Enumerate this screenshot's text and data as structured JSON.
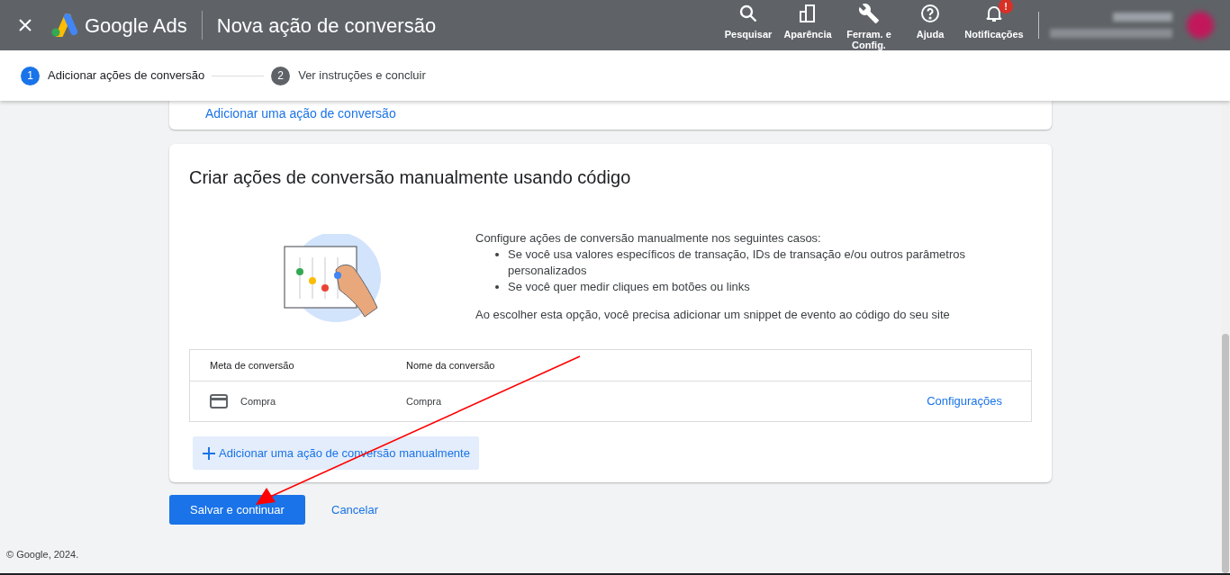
{
  "header": {
    "brand": "Google Ads",
    "title": "Nova ação de conversão",
    "actions": [
      {
        "kind": "search",
        "label": "Pesquisar"
      },
      {
        "kind": "appearance",
        "label": "Aparência"
      },
      {
        "kind": "tools",
        "label": "Ferram. e Config."
      },
      {
        "kind": "help",
        "label": "Ajuda"
      },
      {
        "kind": "bell",
        "label": "Notificações",
        "badge": "!"
      }
    ]
  },
  "stepper": [
    {
      "number": "1",
      "label": "Adicionar ações de conversão",
      "selected": true
    },
    {
      "number": "2",
      "label": "Ver instruções e concluir",
      "selected": false
    }
  ],
  "previous_card": {
    "link": "Adicionar uma ação de conversão"
  },
  "manual_card": {
    "title": "Criar ações de conversão manualmente usando código",
    "intro": "Configure ações de conversão manualmente nos seguintes casos:",
    "bullets": [
      "Se você usa valores específicos de transação, IDs de transação e/ou outros parâmetros personalizados",
      "Se você quer medir cliques em botões ou links"
    ],
    "note": "Ao escolher esta opção, você precisa adicionar um snippet de evento ao código do seu site",
    "table": {
      "columns": [
        "Meta de conversão",
        "Nome da conversão"
      ],
      "rows": [
        {
          "goal": "Compra",
          "name": "Compra",
          "action": "Configurações"
        }
      ]
    },
    "add_button": "Adicionar uma ação de conversão manualmente"
  },
  "buttons": {
    "primary": "Salvar e continuar",
    "secondary": "Cancelar"
  },
  "footer": "© Google, 2024."
}
